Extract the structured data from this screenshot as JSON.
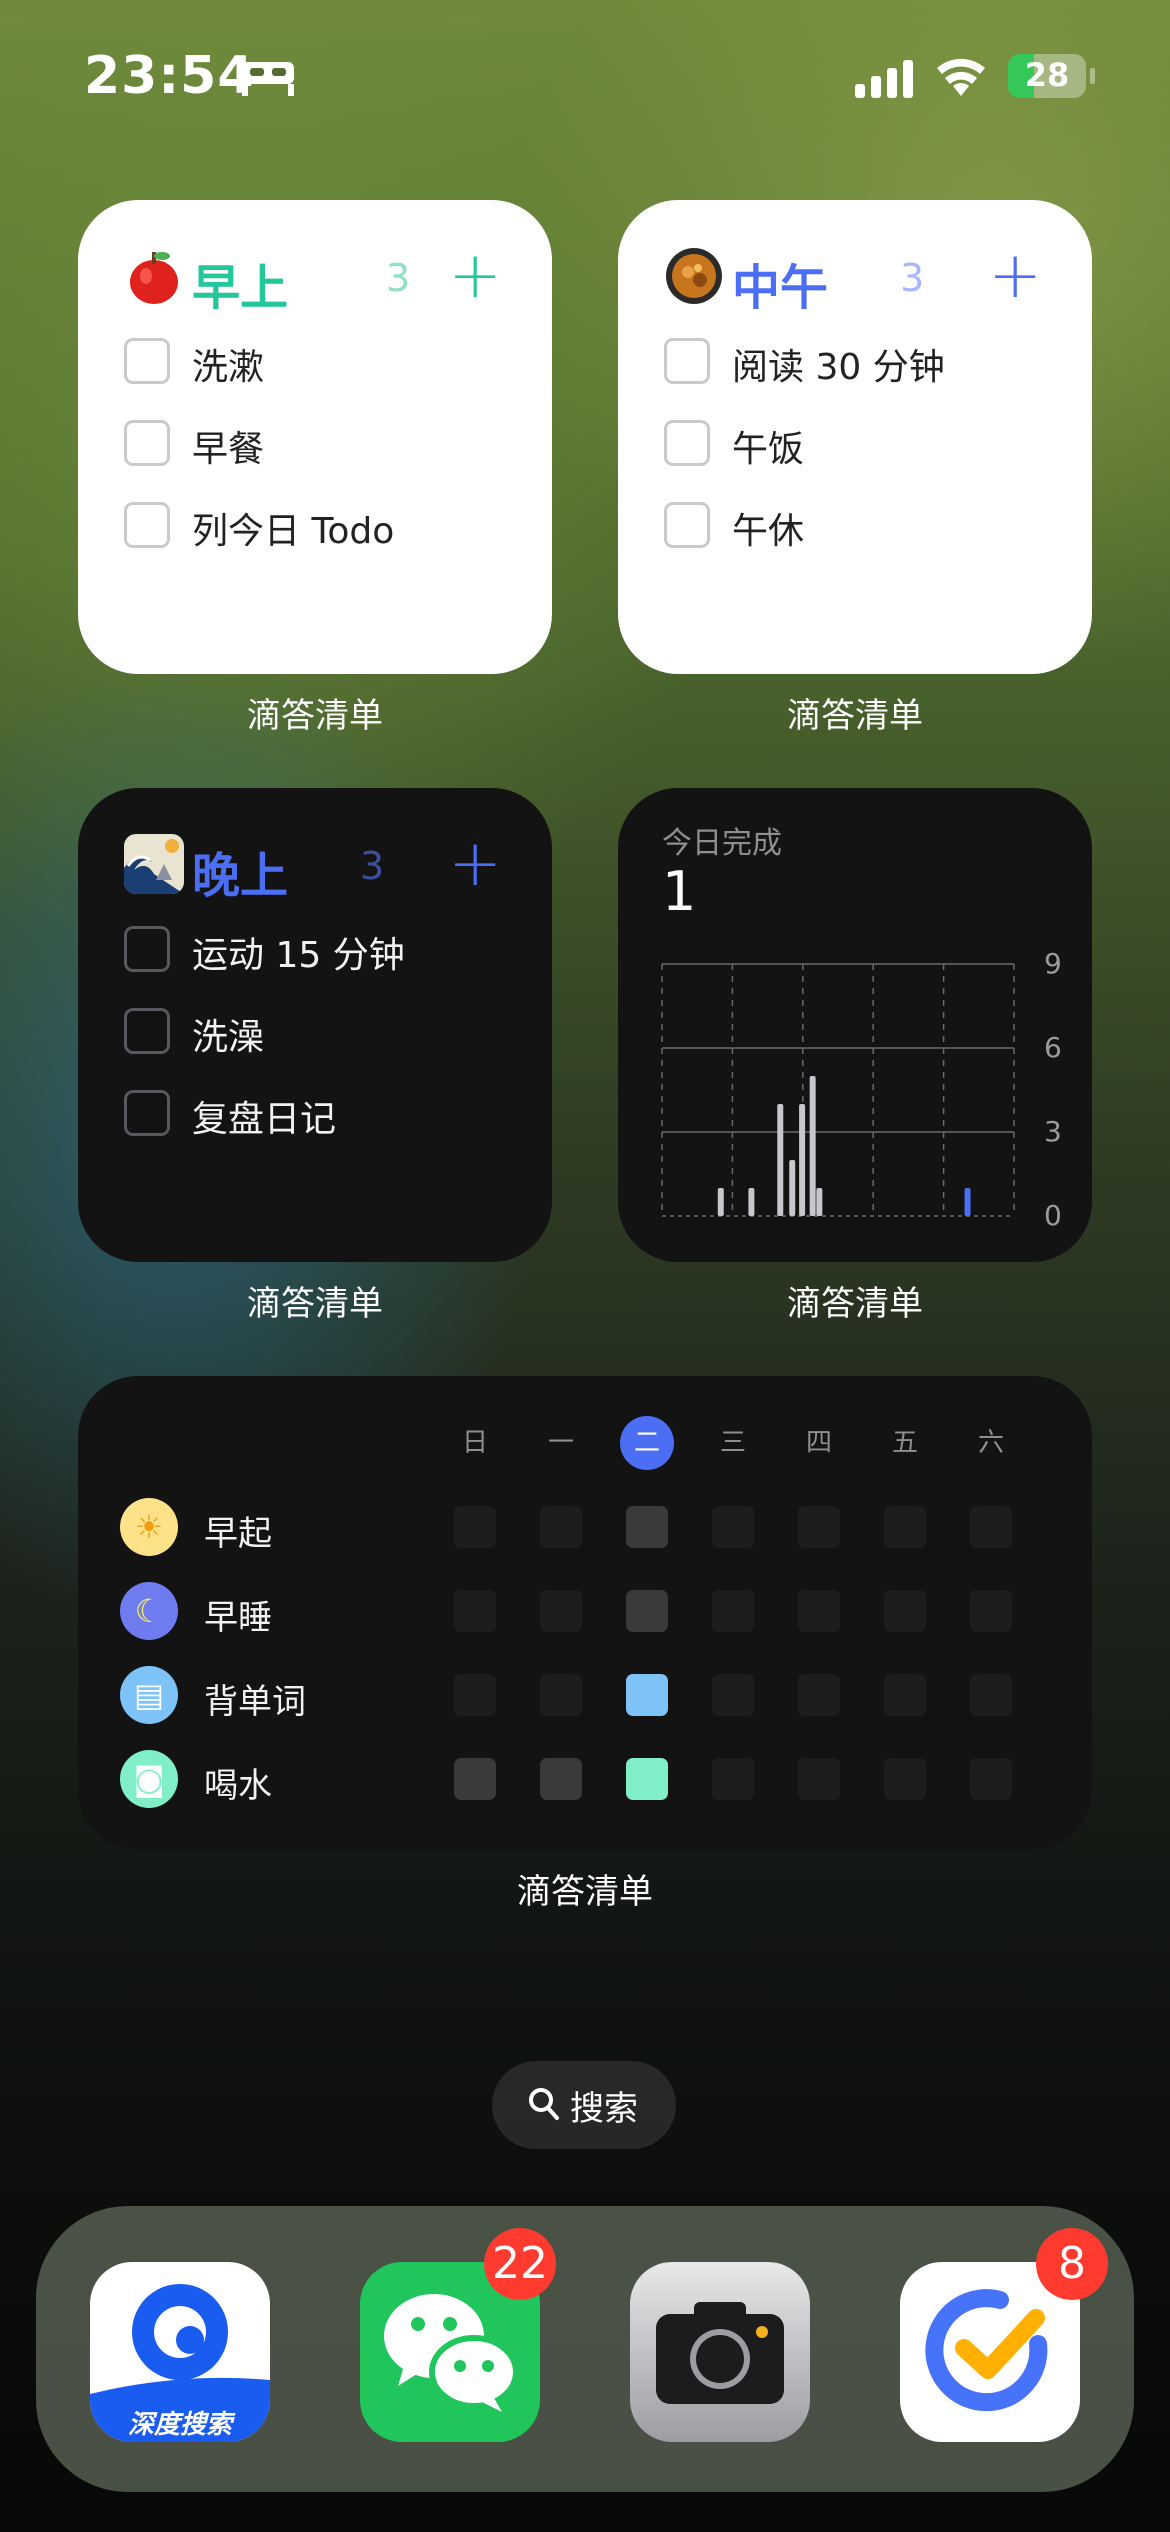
{
  "status_bar": {
    "time": "23:54",
    "battery": "28"
  },
  "widgets": [
    {
      "title": "早上",
      "count": "3",
      "accent": "#22c79a",
      "icon": "apple-icon",
      "caption": "滴答清单",
      "tasks": [
        "洗漱",
        "早餐",
        "列今日 Todo"
      ]
    },
    {
      "title": "中午",
      "count": "3",
      "accent": "#4c6ef5",
      "icon": "food-bowl-icon",
      "caption": "滴答清单",
      "tasks": [
        "阅读 30 分钟",
        "午饭",
        "午休"
      ]
    },
    {
      "title": "晚上",
      "count": "3",
      "accent": "#4c6ef5",
      "icon": "wave-painting-icon",
      "caption": "滴答清单",
      "tasks": [
        "运动 15 分钟",
        "洗澡",
        "复盘日记"
      ]
    }
  ],
  "stats_widget": {
    "label": "今日完成",
    "value": "1",
    "caption": "滴答清单",
    "chart_data": {
      "type": "bar",
      "y_ticks": [
        "9",
        "6",
        "3",
        "0"
      ],
      "ylim": [
        0,
        9
      ],
      "grid": true,
      "values": [
        1,
        1,
        4,
        2,
        4,
        5,
        1,
        1
      ],
      "highlight_color": "#4c6ef5"
    }
  },
  "habits_widget": {
    "caption": "滴答清单",
    "days": [
      "日",
      "一",
      "二",
      "三",
      "四",
      "五",
      "六"
    ],
    "current_day_index": 2,
    "habits": [
      {
        "name": "早起",
        "icon": "sun-icon",
        "icon_color": "#fde28a",
        "glyph": "☀",
        "done": [
          false,
          false,
          true,
          false,
          false,
          false,
          false
        ],
        "done_color": "#3a3a3c"
      },
      {
        "name": "早睡",
        "icon": "moon-sleep-icon",
        "icon_color": "#6f7cf0",
        "glyph": "☾",
        "done": [
          false,
          false,
          true,
          false,
          false,
          false,
          false
        ],
        "done_color": "#3a3a3c"
      },
      {
        "name": "背单词",
        "icon": "book-icon",
        "icon_color": "#7ec3f7",
        "glyph": "▤",
        "done": [
          false,
          false,
          true,
          false,
          false,
          false,
          false
        ],
        "done_color": "#7ec3f7"
      },
      {
        "name": "喝水",
        "icon": "water-glass-icon",
        "icon_color": "#80efc8",
        "glyph": "◙",
        "done": [
          true,
          true,
          true,
          false,
          false,
          false,
          false
        ],
        "done_color": "#80efc8"
      }
    ]
  },
  "search": {
    "label": "搜索"
  },
  "dock": {
    "apps": [
      {
        "name": "deep-search-app",
        "label": "深度搜索",
        "badge": ""
      },
      {
        "name": "wechat-app",
        "label": "",
        "badge": "22"
      },
      {
        "name": "camera-app",
        "label": "",
        "badge": ""
      },
      {
        "name": "ticktick-app",
        "label": "",
        "badge": "8"
      }
    ]
  }
}
